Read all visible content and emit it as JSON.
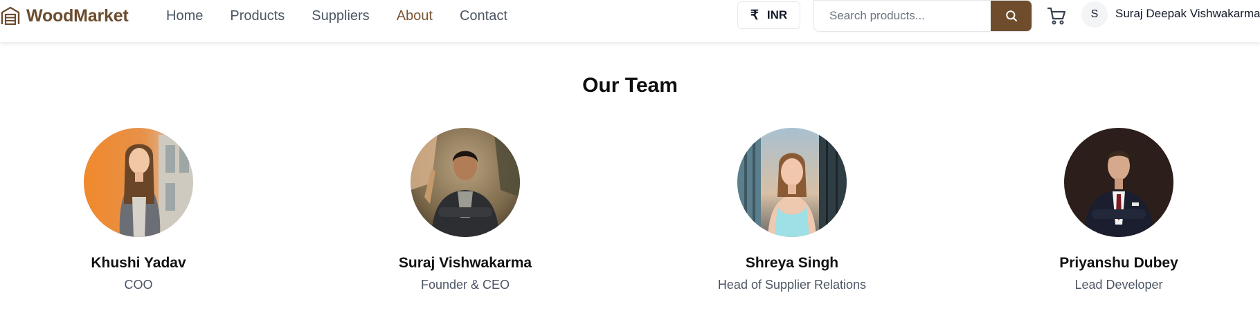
{
  "brand": {
    "name": "WoodMarket",
    "icon": "warehouse-icon",
    "color": "#6b4c2e"
  },
  "nav": {
    "links": [
      {
        "label": "Home",
        "active": false
      },
      {
        "label": "Products",
        "active": false
      },
      {
        "label": "Suppliers",
        "active": false
      },
      {
        "label": "About",
        "active": true
      },
      {
        "label": "Contact",
        "active": false
      }
    ],
    "active_color": "#7a5530"
  },
  "currency": {
    "symbol": "₹",
    "code": "INR"
  },
  "search": {
    "placeholder": "Search products...",
    "value": "",
    "button_color": "#6e4c2c",
    "icon": "search-icon"
  },
  "cart": {
    "icon": "shopping-cart-icon"
  },
  "user": {
    "initial": "S",
    "name": "Suraj Deepak Vishwakarma"
  },
  "team": {
    "title": "Our Team",
    "members": [
      {
        "name": "Khushi Yadav",
        "role": "COO"
      },
      {
        "name": "Suraj Vishwakarma",
        "role": "Founder & CEO"
      },
      {
        "name": "Shreya Singh",
        "role": "Head of Supplier Relations"
      },
      {
        "name": "Priyanshu Dubey",
        "role": "Lead Developer"
      }
    ]
  }
}
